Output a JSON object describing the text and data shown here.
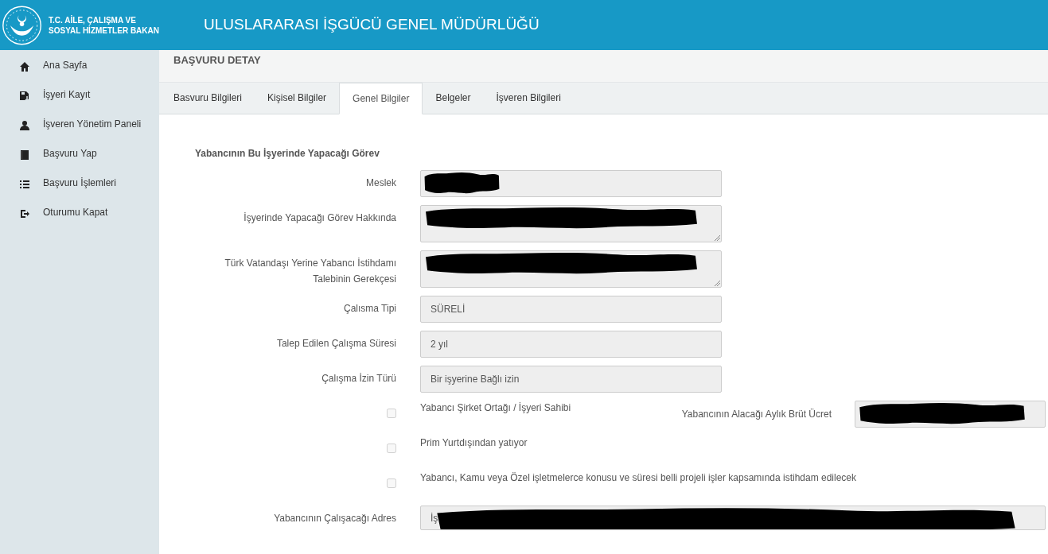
{
  "header": {
    "logo_text": [
      "T.C. AİLE, ÇALIŞMA VE",
      "SOSYAL HİZMETLER BAKAN"
    ],
    "title": "ULUSLARARASI İŞGÜCÜ GENEL MÜDÜRLÜĞÜ"
  },
  "sidebar": {
    "items": [
      {
        "kind": "home",
        "label": "Ana Sayfa"
      },
      {
        "kind": "save",
        "label": "İşyeri Kayıt"
      },
      {
        "kind": "user",
        "label": "İşveren Yönetim Paneli"
      },
      {
        "kind": "book",
        "label": "Başvuru Yap"
      },
      {
        "kind": "list",
        "label": "Başvuru İşlemleri"
      },
      {
        "kind": "logout",
        "label": "Oturumu Kapat"
      }
    ]
  },
  "page_title": "BAŞVURU DETAY",
  "tabs": [
    {
      "label": "Basvuru Bilgileri",
      "selected": false
    },
    {
      "label": "Kişisel Bilgiler",
      "selected": false
    },
    {
      "label": "Genel Bilgiler",
      "selected": true
    },
    {
      "label": "Belgeler",
      "selected": false
    },
    {
      "label": "İşveren Bilgileri",
      "selected": false
    }
  ],
  "section_title": "Yabancının Bu İşyerinde Yapacağı Görev",
  "fields": [
    {
      "kind": "input",
      "label": "Meslek",
      "redacted": true
    },
    {
      "kind": "textarea",
      "label": "İşyerinde Yapacağı Görev Hakkında",
      "redacted": true
    },
    {
      "kind": "textarea",
      "label": "Türk Vatandaşı Yerine Yabancı İstihdamı Talebinin Gerekçesi",
      "redacted": true
    },
    {
      "kind": "input",
      "label": "Çalısma Tipi",
      "value": "SÜRELİ"
    },
    {
      "kind": "input",
      "label": "Talep Edilen Çalışma Süresi",
      "value": "2 yıl"
    },
    {
      "kind": "input",
      "label": "Çalışma İzin Türü",
      "value": "Bir işyerine Bağlı izin"
    }
  ],
  "checkboxes": [
    {
      "label": "Yabancı Şirket Ortağı / İşyeri Sahibi",
      "checked": false,
      "side_field": {
        "label": "Yabancının Alacağı Aylık Brüt Ücret",
        "redacted": true
      }
    },
    {
      "label": "Prim Yurtdışından yatıyor",
      "checked": false
    },
    {
      "label": "Yabancı, Kamu veya Özel işletmelerce konusu ve süresi belli projeli işler kapsamında istihdam edilecek",
      "checked": false
    }
  ],
  "address": {
    "label": "Yabancının Çalışacağı Adres",
    "value": "İş",
    "redacted": true
  }
}
